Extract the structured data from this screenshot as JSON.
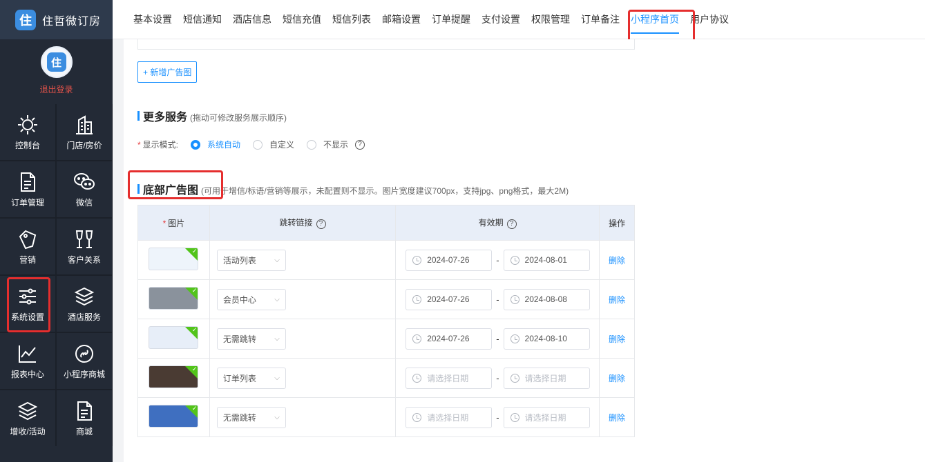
{
  "brand": {
    "name": "住哲微订房"
  },
  "user": {
    "logout": "退出登录"
  },
  "sidebar": {
    "items": [
      {
        "label": "控制台",
        "icon": "sun-icon"
      },
      {
        "label": "门店/房价",
        "icon": "building-icon"
      },
      {
        "label": "订单管理",
        "icon": "document-icon"
      },
      {
        "label": "微信",
        "icon": "wechat-icon"
      },
      {
        "label": "营销",
        "icon": "tag-icon"
      },
      {
        "label": "客户关系",
        "icon": "wine-glasses-icon"
      },
      {
        "label": "系统设置",
        "icon": "sliders-icon"
      },
      {
        "label": "酒店服务",
        "icon": "layers-icon"
      },
      {
        "label": "报表中心",
        "icon": "line-chart-icon"
      },
      {
        "label": "小程序商城",
        "icon": "link-circle-icon"
      },
      {
        "label": "增收/活动",
        "icon": "layers-icon"
      },
      {
        "label": "商城",
        "icon": "document-icon"
      }
    ]
  },
  "tabs": [
    "基本设置",
    "短信通知",
    "酒店信息",
    "短信充值",
    "短信列表",
    "邮箱设置",
    "订单提醒",
    "支付设置",
    "权限管理",
    "订单备注",
    "小程序首页",
    "用户协议"
  ],
  "active_tab": "小程序首页",
  "add_ad_button": "+ 新增广告图",
  "more_services": {
    "title": "更多服务",
    "desc": "(拖动可修改服务展示顺序)",
    "mode_label": "显示模式:",
    "options": [
      "系统自动",
      "自定义",
      "不显示"
    ],
    "selected": "系统自动"
  },
  "bottom_ads": {
    "title": "底部广告图",
    "desc": "(可用于增信/标语/营销等展示，未配置则不显示。图片宽度建议700px，支持jpg、png格式，最大2M)",
    "columns": [
      "图片",
      "跳转链接",
      "有效期",
      "操作"
    ],
    "rows": [
      {
        "thumb_color": "#eef4fb",
        "link": "活动列表",
        "start": "2024-07-26",
        "end": "2024-08-01",
        "action": "删除"
      },
      {
        "thumb_color": "#8a929c",
        "link": "会员中心",
        "start": "2024-07-26",
        "end": "2024-08-08",
        "action": "删除"
      },
      {
        "thumb_color": "#e7eef8",
        "link": "无需跳转",
        "start": "2024-07-26",
        "end": "2024-08-10",
        "action": "删除"
      },
      {
        "thumb_color": "#4a3b33",
        "link": "订单列表",
        "start": "请选择日期",
        "end": "请选择日期",
        "action": "删除"
      },
      {
        "thumb_color": "#3f6fc0",
        "link": "无需跳转",
        "start": "请选择日期",
        "end": "请选择日期",
        "action": "删除"
      }
    ]
  }
}
